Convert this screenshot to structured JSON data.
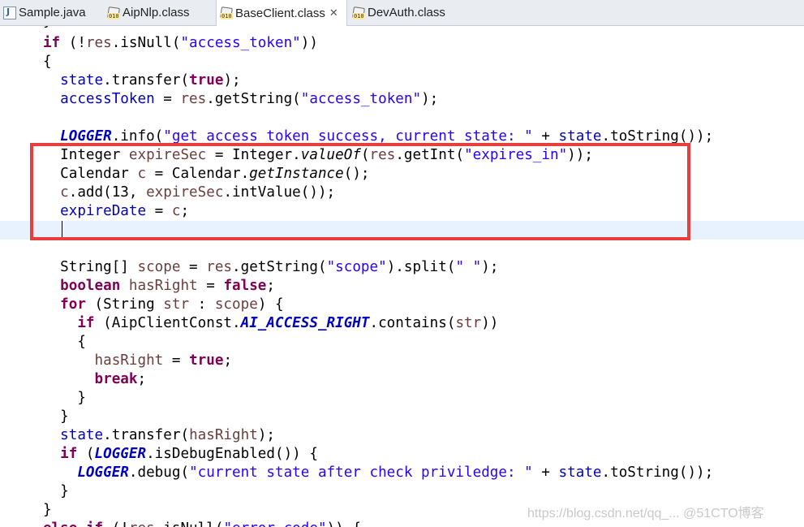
{
  "tabs": [
    {
      "label": "Sample.java",
      "icon": "java-file-icon"
    },
    {
      "label": "AipNlp.class",
      "icon": "class-file-icon"
    },
    {
      "label": "BaseClient.class",
      "icon": "class-file-icon",
      "active": true,
      "close": "✕"
    },
    {
      "label": "DevAuth.class",
      "icon": "class-file-icon"
    }
  ],
  "code": {
    "l0": {
      "a": "if",
      "b": " (!",
      "c": "res",
      "d": ".isNull(",
      "e": "\"access_token\"",
      "f": "))"
    },
    "l1": {
      "a": "{"
    },
    "l2": {
      "a": "state",
      "b": ".transfer(",
      "c": "true",
      "d": ");"
    },
    "l3": {
      "a": "accessToken",
      "b": " = ",
      "c": "res",
      "d": ".getString(",
      "e": "\"access_token\"",
      "f": ");"
    },
    "l5": {
      "a": "LOGGER",
      "b": ".info(",
      "c": "\"get access token success, current state: \"",
      "d": " + ",
      "e": "state",
      "f": ".toString());"
    },
    "l6": {
      "a": "Integer ",
      "b": "expireSec",
      "c": " = Integer.",
      "d": "valueOf",
      "e": "(",
      "f": "res",
      "g": ".getInt(",
      "h": "\"expires_in\"",
      "i": "));"
    },
    "l7": {
      "a": "Calendar ",
      "b": "c",
      "c": " = Calendar.",
      "d": "getInstance",
      "e": "();"
    },
    "l8": {
      "a": "c",
      "b": ".add(13, ",
      "c": "expireSec",
      "d": ".intValue());"
    },
    "l9": {
      "a": "expireDate",
      "b": " = ",
      "c": "c",
      "d": ";"
    },
    "l11": {
      "a": "String[] ",
      "b": "scope",
      "c": " = ",
      "d": "res",
      "e": ".getString(",
      "f": "\"scope\"",
      "g": ").split(",
      "h": "\" \"",
      "i": ");"
    },
    "l12": {
      "a": "boolean",
      "b": " ",
      "c": "hasRight",
      "d": " = ",
      "e": "false",
      "f": ";"
    },
    "l13": {
      "a": "for",
      "b": " (String ",
      "c": "str",
      "d": " : ",
      "e": "scope",
      "f": ") {"
    },
    "l14": {
      "a": "if",
      "b": " (AipClientConst.",
      "c": "AI_ACCESS_RIGHT",
      "d": ".contains(",
      "e": "str",
      "f": "))"
    },
    "l15": {
      "a": "{"
    },
    "l16": {
      "a": "hasRight",
      "b": " = ",
      "c": "true",
      "d": ";"
    },
    "l17": {
      "a": "break",
      "b": ";"
    },
    "l18": {
      "a": "}"
    },
    "l19": {
      "a": "}"
    },
    "l20": {
      "a": "state",
      "b": ".transfer(",
      "c": "hasRight",
      "d": ");"
    },
    "l21": {
      "a": "if",
      "b": " (",
      "c": "LOGGER",
      "d": ".isDebugEnabled()) {"
    },
    "l22": {
      "a": "LOGGER",
      "b": ".debug(",
      "c": "\"current state after check priviledge: \"",
      "d": " + ",
      "e": "state",
      "f": ".toString());"
    },
    "l23": {
      "a": "}"
    },
    "l24": {
      "a": "}"
    },
    "l25": {
      "a": "else",
      "b": " ",
      "c": "if",
      "d": " (!",
      "e": "res",
      "f": ".isNull(",
      "g": "\"error_code\"",
      "h": ")) {"
    }
  },
  "watermark": "https://blog.csdn.net/qq_...  @51CTO博客",
  "colors": {
    "highlight_box": "#e83e3e",
    "current_line": "#e8f2fe",
    "keyword": "#7f0055",
    "string": "#2a00ff",
    "field": "#0000c0"
  }
}
